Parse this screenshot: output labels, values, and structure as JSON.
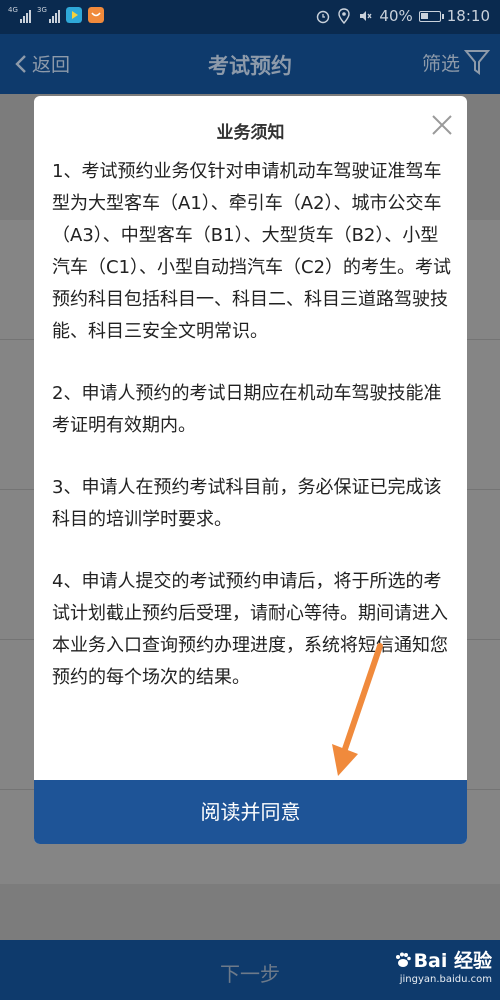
{
  "status_bar": {
    "signal_1_label": "4G",
    "signal_2_label": "3G",
    "battery": "40%",
    "battery_level": 0.4,
    "time": "18:10"
  },
  "header": {
    "back_label": "返回",
    "title": "考试预约",
    "filter_label": "筛选"
  },
  "modal": {
    "title": "业务须知",
    "paragraphs": [
      "1、考试预约业务仅针对申请机动车驾驶证准驾车型为大型客车（A1）、牵引车（A2）、城市公交车（A3）、中型客车（B1）、大型货车（B2）、小型汽车（C1）、小型自动挡汽车（C2）的考生。考试预约科目包括科目一、科目二、科目三道路驾驶技能、科目三安全文明常识。",
      "2、申请人预约的考试日期应在机动车驾驶技能准考证明有效期内。",
      "3、申请人在预约考试科目前，务必保证已完成该科目的培训学时要求。",
      "4、申请人提交的考试预约申请后，将于所选的考试计划截止预约后受理，请耐心等待。期间请进入本业务入口查询预约办理进度，系统将短信通知您预约的每个场次的结果。"
    ],
    "agree_label": "阅读并同意"
  },
  "footer": {
    "next_label": "下一步"
  },
  "watermark": {
    "brand": "Bai 经验",
    "url": "jingyan.baidu.com"
  },
  "colors": {
    "header_bg": "#0e3a6c",
    "agree_button": "#1e5497",
    "arrow": "#f08a3c"
  }
}
